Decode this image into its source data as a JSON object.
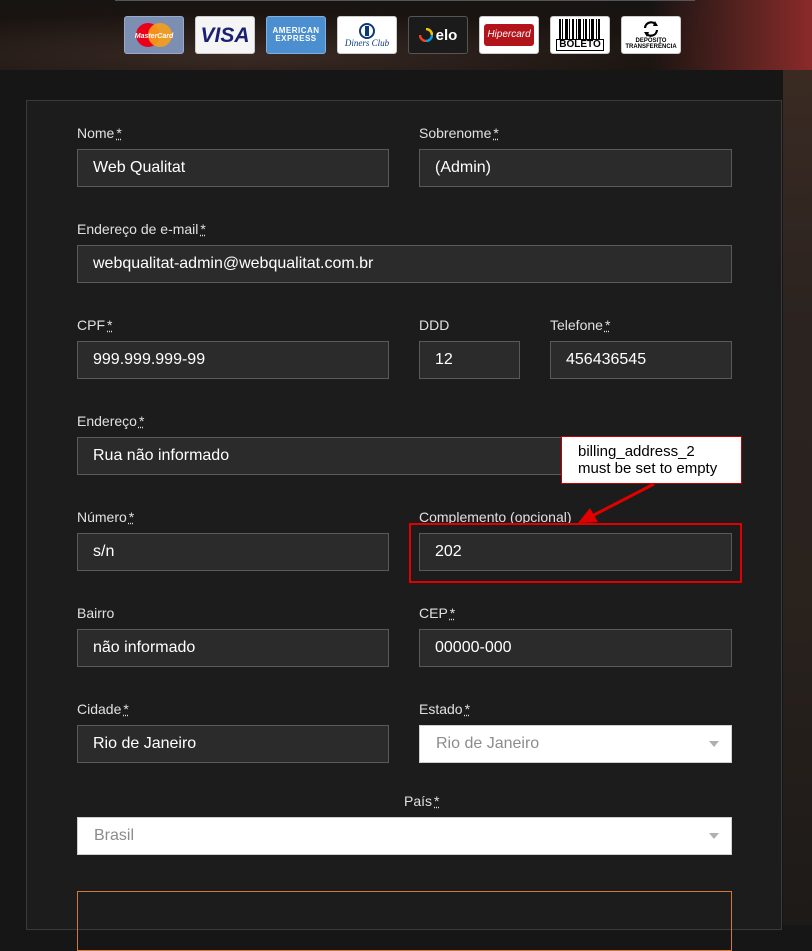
{
  "payment_methods": [
    {
      "name": "mastercard-logo",
      "label": "MasterCard",
      "color": "#d0342c"
    },
    {
      "name": "visa-logo",
      "label": "VISA",
      "color": "#1a1f71"
    },
    {
      "name": "amex-logo",
      "label": "AMERICAN EXPRESS",
      "color": "#2e77bc"
    },
    {
      "name": "diners-logo",
      "label": "Diners Club",
      "color": "#0b3a77"
    },
    {
      "name": "elo-logo",
      "label": "elo",
      "color": "#ffffff"
    },
    {
      "name": "hipercard-logo",
      "label": "Hipercard",
      "color": "#b3131b"
    },
    {
      "name": "boleto-logo",
      "label": "BOLETO",
      "color": "#000000"
    },
    {
      "name": "deposito-logo",
      "label": "DEPÓSITO TRANSFERÊNCIA",
      "color": "#000000"
    }
  ],
  "form": {
    "required_marker": "*",
    "nome": {
      "label": "Nome",
      "value": "Web Qualitat"
    },
    "sobrenome": {
      "label": "Sobrenome",
      "value": "(Admin)"
    },
    "email": {
      "label": "Endereço de e-mail",
      "value": "webqualitat-admin@webqualitat.com.br"
    },
    "cpf": {
      "label": "CPF",
      "value": "999.999.999-99"
    },
    "ddd": {
      "label": "DDD",
      "value": "12"
    },
    "telefone": {
      "label": "Telefone",
      "value": "456436545"
    },
    "endereco": {
      "label": "Endereço",
      "value": "Rua não informado"
    },
    "numero": {
      "label": "Número",
      "value": "s/n"
    },
    "complemento": {
      "label": "Complemento (opcional)",
      "value": "202"
    },
    "bairro": {
      "label": "Bairro",
      "value": "não informado"
    },
    "cep": {
      "label": "CEP",
      "value": "00000-000"
    },
    "cidade": {
      "label": "Cidade",
      "value": "Rio de Janeiro"
    },
    "estado": {
      "label": "Estado",
      "value": "Rio de Janeiro"
    },
    "pais": {
      "label": "País",
      "value": "Brasil"
    }
  },
  "annotation": {
    "line1": "billing_address_2",
    "line2": "must be set to empty",
    "color": "#e00000"
  }
}
